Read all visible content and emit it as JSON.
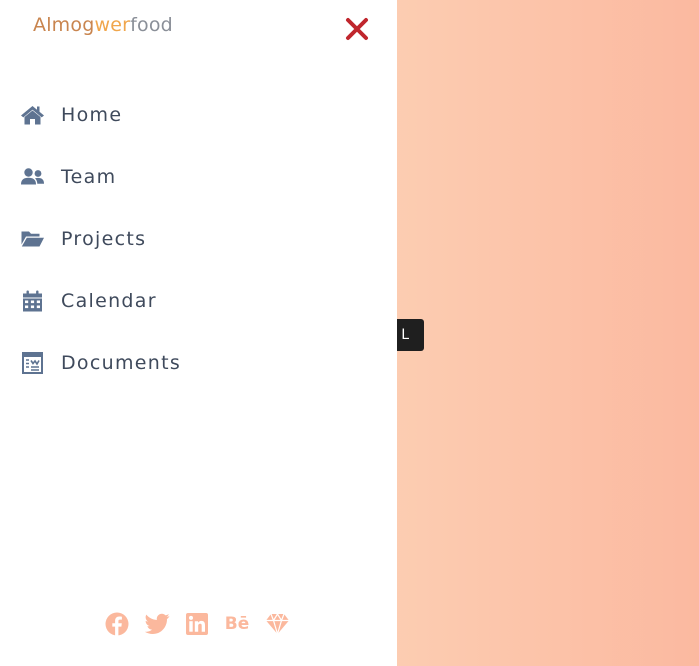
{
  "brand": {
    "part1": "Almog",
    "part2": "wer",
    "part3": "food"
  },
  "close_icon": "close-icon",
  "nav": {
    "items": [
      {
        "label": "Home",
        "icon": "home-icon"
      },
      {
        "label": "Team",
        "icon": "users-icon"
      },
      {
        "label": "Projects",
        "icon": "folder-open-icon"
      },
      {
        "label": "Calendar",
        "icon": "calendar-icon"
      },
      {
        "label": "Documents",
        "icon": "document-icon"
      }
    ]
  },
  "background_button": {
    "visible_text": "L"
  },
  "social": {
    "items": [
      "facebook-icon",
      "twitter-icon",
      "linkedin-icon",
      "behance-icon",
      "sketch-icon"
    ],
    "behance_text": "Bē"
  },
  "colors": {
    "nav_icon": "#5e7391",
    "nav_text": "#3f4a5c",
    "close": "#c0262d",
    "social": "#fbb89d",
    "brand_primary": "#c9854f",
    "brand_accent": "#f0a64c",
    "brand_muted": "#8a8f98"
  }
}
